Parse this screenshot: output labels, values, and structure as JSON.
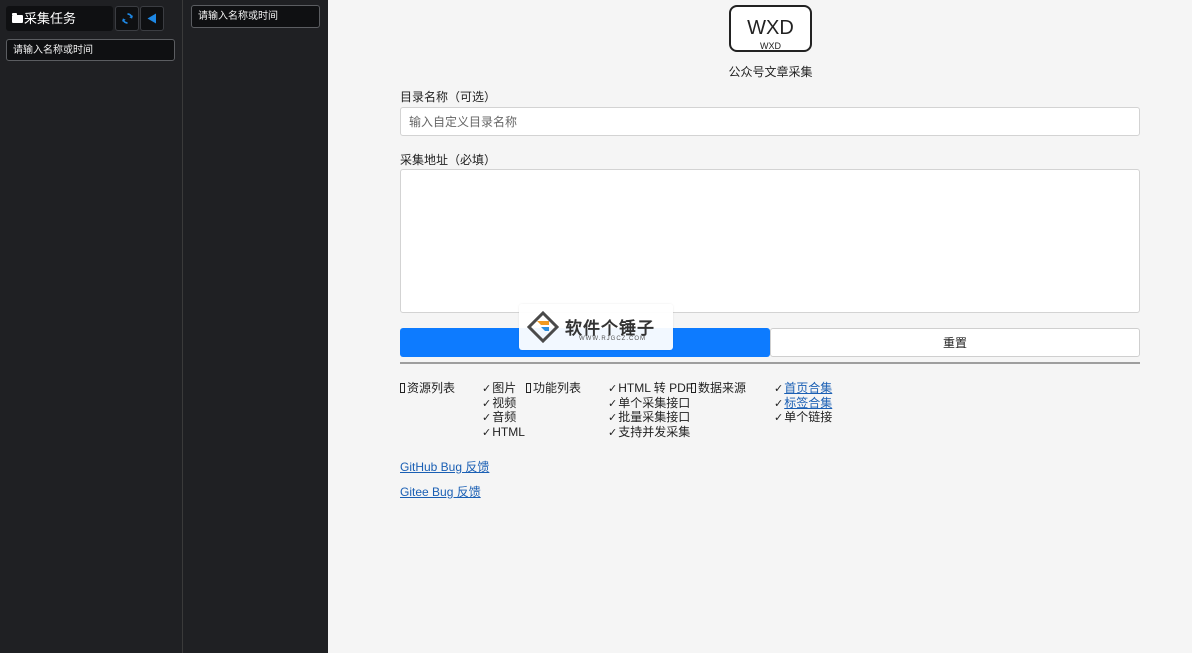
{
  "sidebar_left": {
    "title": "采集任务",
    "search_placeholder": "请输入名称或时间",
    "refresh_icon": "refresh-icon",
    "collapse_icon": "triangle-left-icon"
  },
  "sidebar_mid": {
    "search_placeholder": "请输入名称或时间"
  },
  "main": {
    "logo": {
      "text": "WXD",
      "sub": "WXD"
    },
    "subtitle": "公众号文章采集",
    "dir_label": "目录名称（可选）",
    "dir_placeholder": "输入自定义目录名称",
    "url_label": "采集地址（必填）",
    "url_value": "",
    "start_label": "",
    "reset_label": "重置",
    "features": {
      "resources": {
        "heading": "资源列表",
        "items": [
          "图片",
          "视频",
          "音频",
          "HTML"
        ]
      },
      "functions": {
        "heading": "功能列表",
        "items": [
          "HTML 转 PDF",
          "单个采集接口",
          "批量采集接口",
          "支持并发采集"
        ]
      },
      "sources": {
        "heading": "数据来源",
        "items": [
          "首页合集",
          "标签合集",
          "单个链接"
        ]
      }
    },
    "links": {
      "github": "GitHub Bug 反馈",
      "gitee": "Gitee Bug 反馈"
    }
  },
  "watermark": {
    "title": "软件个锤子",
    "sub": "WWW.RJGCZ.COM"
  },
  "colors": {
    "primary_button": "#0d7bff",
    "sidebar_bg": "#1f2023",
    "link": "#1a5fb4"
  }
}
